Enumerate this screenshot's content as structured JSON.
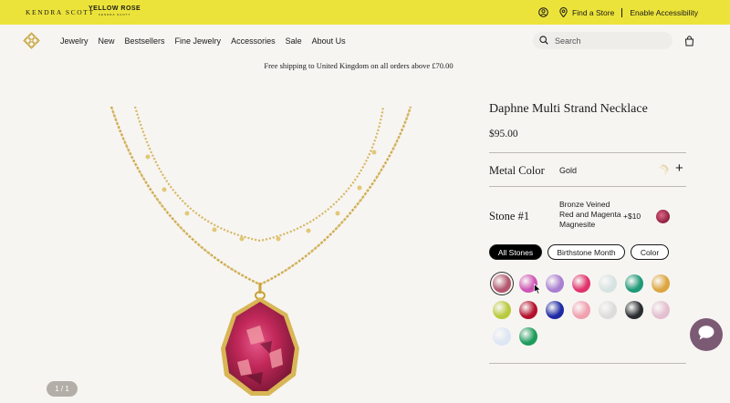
{
  "topbar": {
    "brand_primary": "KENDRA SCOTT",
    "brand_secondary": "YELLOW ROSE",
    "brand_secondary_sub": "KENDRA SCOTT",
    "find_store": "Find a Store",
    "accessibility": "Enable Accessibility",
    "background": "#ece33a"
  },
  "nav": {
    "items": [
      "Jewelry",
      "New",
      "Bestsellers",
      "Fine Jewelry",
      "Accessories",
      "Sale",
      "About Us"
    ],
    "search_placeholder": "Search",
    "icons": [
      "logo-icon",
      "search-icon",
      "bag-icon"
    ]
  },
  "promo": "Free shipping to United Kingdom on all orders above £70.00",
  "product": {
    "title": "Daphne Multi Strand Necklace",
    "price": "$95.00",
    "pager": "1 / 1",
    "metal": {
      "label": "Metal Color",
      "value": "Gold"
    },
    "stone": {
      "label": "Stone #1",
      "selected_name": "Bronze Veined Red and Magenta Magnesite",
      "upcharge": "+$10"
    },
    "filters": [
      "All Stones",
      "Birthstone Month",
      "Color"
    ],
    "active_filter": "All Stones",
    "swatch_colors": [
      "#b3566e",
      "#cf55b4",
      "#a97fd1",
      "#e0336e",
      "#d6e3e2",
      "#1f9a78",
      "#dda53f",
      "#b9c93c",
      "#b3122c",
      "#1e2aa4",
      "#f0a0ae",
      "#dcdcdc",
      "#2a2d30",
      "#e3bfd0",
      "#dde6f3",
      "#1e9c5c"
    ],
    "selected_swatch": 0
  }
}
